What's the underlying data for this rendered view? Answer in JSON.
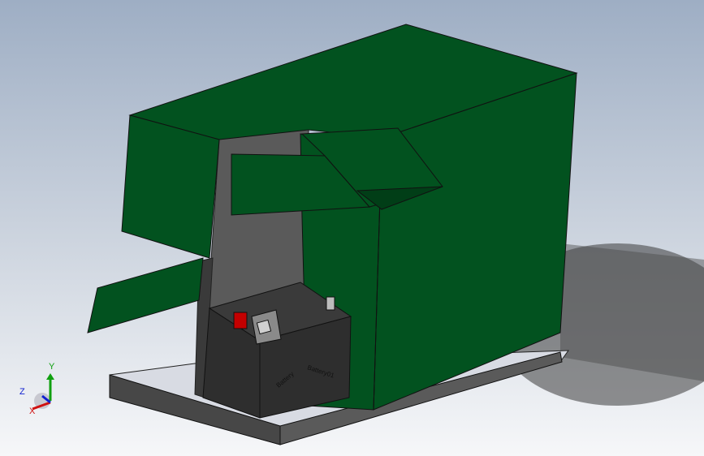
{
  "viewport": {
    "background_top": "#9eaec4",
    "background_bottom": "#f6f7f9"
  },
  "model": {
    "housing_color": "#02521f",
    "housing_dark_color": "#013e17",
    "frame_color": "#4a4a4a",
    "battery_color": "#2e2e2e",
    "battery_terminal_color": "#c40000",
    "battery_label_left": "Battery",
    "battery_label_right": "Battery01"
  },
  "triad": {
    "x_label": "X",
    "y_label": "Y",
    "z_label": "Z",
    "x_color": "#d01010",
    "y_color": "#10a010",
    "z_color": "#1020d0"
  }
}
